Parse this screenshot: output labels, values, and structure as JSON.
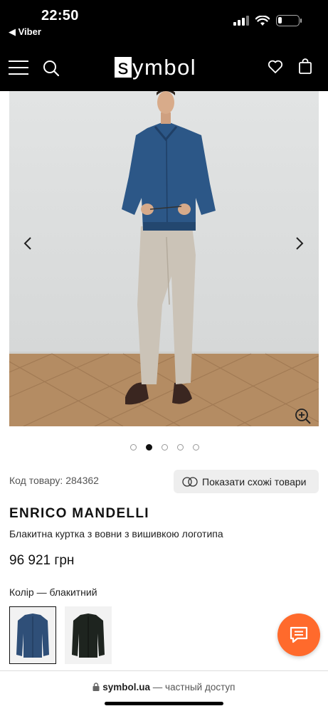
{
  "status": {
    "time": "22:50",
    "back_app": "◀ Viber",
    "battery_level": 0.2
  },
  "header": {
    "logo_letter": "s",
    "logo_rest": "ymbol",
    "icons": [
      "menu-icon",
      "search-icon",
      "heart-icon",
      "bag-icon"
    ]
  },
  "gallery": {
    "slide_count": 5,
    "active_index": 1
  },
  "product": {
    "code_label": "Код товару: 284362",
    "similar_label": "Показати схожі товари",
    "brand": "ENRICO MANDELLI",
    "description": "Блакитна куртка з вовни з вишивкою логотипа",
    "price": "96 921 грн",
    "color_label": "Колір — блакитний",
    "colors": [
      {
        "name": "blue",
        "hex": "#2f4f78",
        "selected": true
      },
      {
        "name": "dark",
        "hex": "#1e241f",
        "selected": false
      }
    ]
  },
  "browser": {
    "domain": "symbol.ua",
    "privacy": " — частный доступ"
  },
  "colors": {
    "accent": "#ff6a2c",
    "header_bg": "#000000"
  }
}
